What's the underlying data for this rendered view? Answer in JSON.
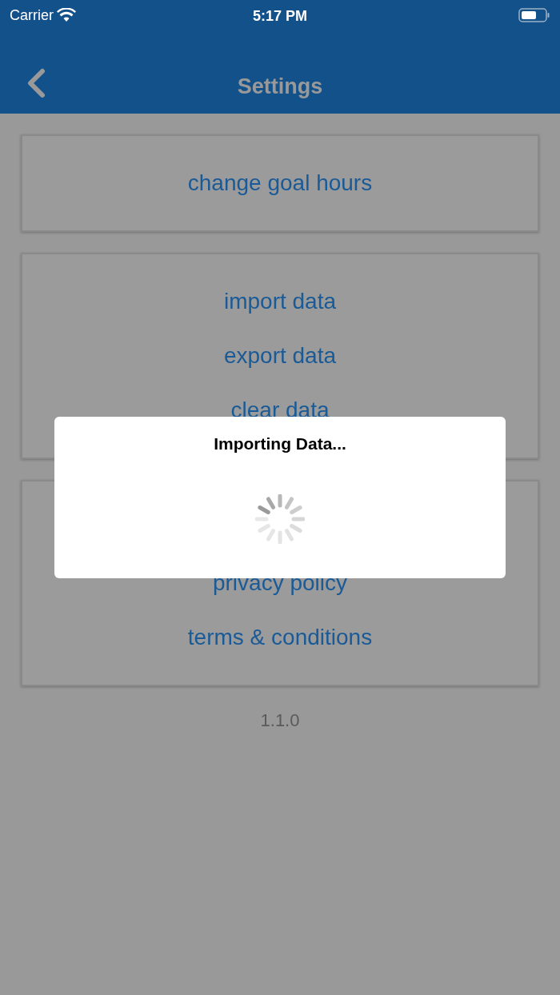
{
  "status_bar": {
    "carrier": "Carrier",
    "time": "5:17 PM"
  },
  "nav_bar": {
    "title": "Settings"
  },
  "sections": [
    {
      "items": [
        {
          "label": "change goal hours"
        }
      ]
    },
    {
      "items": [
        {
          "label": "import data"
        },
        {
          "label": "export data"
        },
        {
          "label": "clear data"
        }
      ]
    },
    {
      "items": [
        {
          "label": "privacy policy"
        },
        {
          "label": "terms & conditions"
        }
      ]
    }
  ],
  "version": "1.1.0",
  "dialog": {
    "title": "Importing Data..."
  }
}
